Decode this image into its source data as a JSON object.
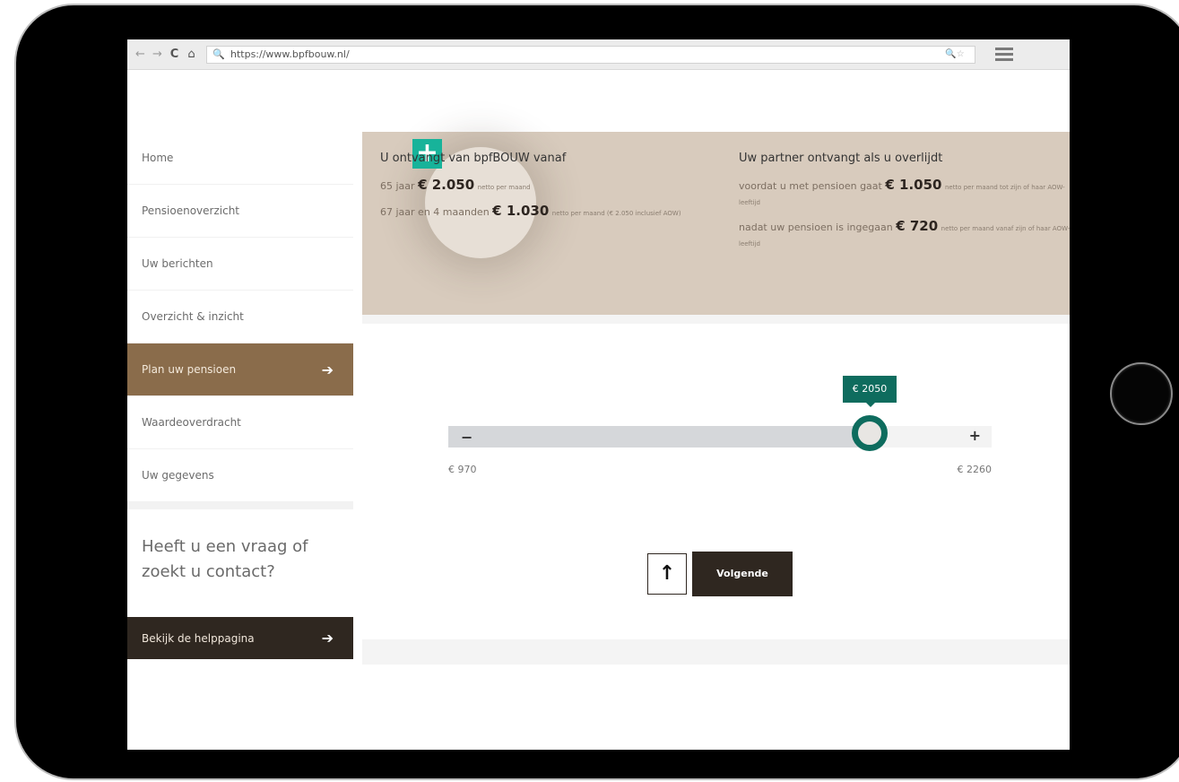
{
  "browser": {
    "url": "https://www.bpfbouw.nl/",
    "nav_back": "←",
    "nav_forward": "→",
    "nav_reload": "C",
    "nav_home": "⌂",
    "search_icon": "🔍",
    "url_actions": "🔍☆"
  },
  "sidebar": {
    "items": [
      {
        "label": "Home"
      },
      {
        "label": "Pensioenoverzicht"
      },
      {
        "label": "Uw berichten"
      },
      {
        "label": "Overzicht & inzicht"
      },
      {
        "label": "Plan uw pensioen",
        "active": true,
        "arrow": "➔"
      },
      {
        "label": "Waardeoverdracht"
      },
      {
        "label": "Uw gegevens"
      }
    ],
    "contact_text": "Heeft u een vraag of zoekt u contact?",
    "help_button": "Bekijk de helppagina",
    "help_arrow": "➔"
  },
  "summary": {
    "plus_icon": "+",
    "left": {
      "title": "U ontvangt van bpfBOUW vanaf",
      "rows": [
        {
          "prefix": "65 jaar",
          "amount": "€ 2.050",
          "suffix": "netto per maand"
        },
        {
          "prefix": "67 jaar en 4 maanden",
          "amount": "€ 1.030",
          "suffix": "netto per maand (€ 2.050 inclusief AOW)"
        }
      ]
    },
    "right": {
      "title": "Uw partner ontvangt als u overlijdt",
      "rows": [
        {
          "prefix": "voordat u met pensioen gaat",
          "amount": "€ 1.050",
          "suffix": "netto per maand tot zijn of haar AOW-leeftijd"
        },
        {
          "prefix": "nadat uw pensioen is ingegaan",
          "amount": "€ 720",
          "suffix": "netto per maand vanaf zijn of haar AOW-leeftijd"
        }
      ]
    }
  },
  "slider": {
    "min": 970,
    "max": 2260,
    "value": 2050,
    "value_label": "€ 2050",
    "min_label": "€ 970",
    "max_label": "€ 2260",
    "minus": "−",
    "plus": "+",
    "accent": "#0e6c5e"
  },
  "actions": {
    "up_icon": "↑",
    "next_label": "Volgende"
  },
  "colors": {
    "brand_brown": "#8a6c4b",
    "dark": "#2f2720",
    "summary_bg": "#d8cbbd",
    "teal_badge": "#17b39a"
  }
}
